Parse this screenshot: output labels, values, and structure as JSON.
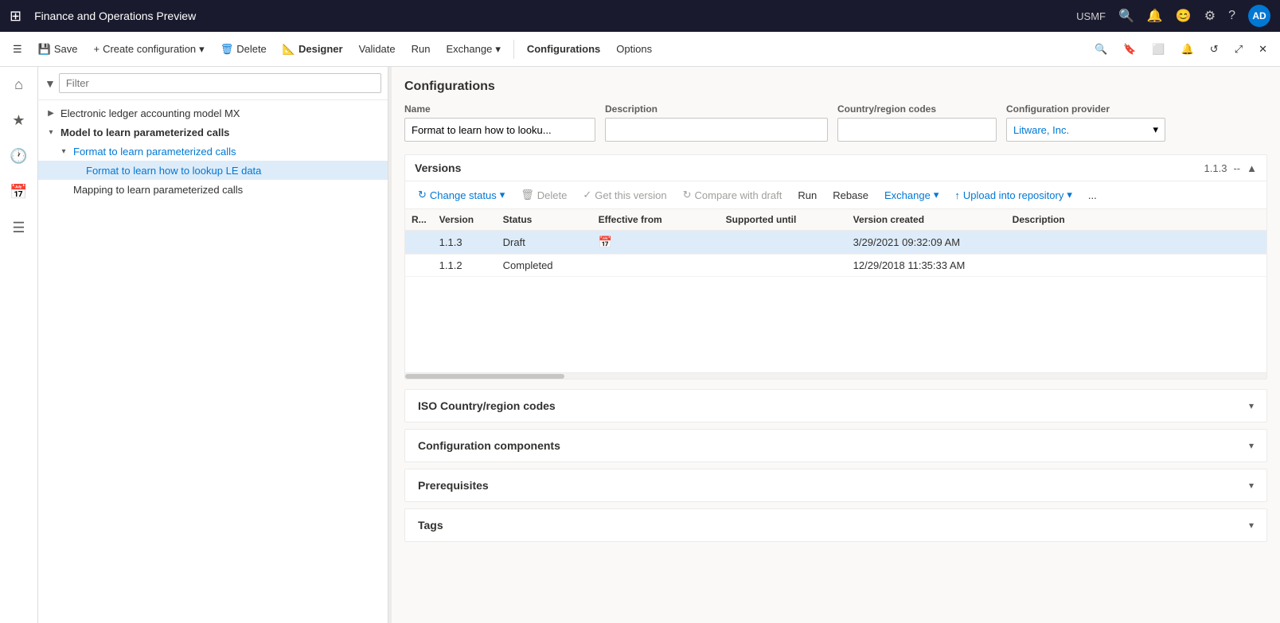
{
  "app": {
    "title": "Finance and Operations Preview",
    "user": "USMF",
    "initials": "AD"
  },
  "toolbar": {
    "save": "Save",
    "create_configuration": "Create configuration",
    "delete": "Delete",
    "designer": "Designer",
    "validate": "Validate",
    "run": "Run",
    "exchange": "Exchange",
    "configurations": "Configurations",
    "options": "Options"
  },
  "filter": {
    "placeholder": "Filter"
  },
  "tree": {
    "items": [
      {
        "id": "electronic",
        "label": "Electronic ledger accounting model MX",
        "level": 0,
        "toggle": "▶",
        "selected": false
      },
      {
        "id": "model",
        "label": "Model to learn parameterized calls",
        "level": 0,
        "toggle": "▾",
        "selected": false
      },
      {
        "id": "format",
        "label": "Format to learn parameterized calls",
        "level": 1,
        "toggle": "▾",
        "selected": false
      },
      {
        "id": "format-lookup",
        "label": "Format to learn how to lookup LE data",
        "level": 2,
        "toggle": "",
        "selected": true
      },
      {
        "id": "mapping",
        "label": "Mapping to learn parameterized calls",
        "level": 1,
        "toggle": "",
        "selected": false
      }
    ]
  },
  "main": {
    "section_title": "Configurations",
    "form": {
      "name_label": "Name",
      "name_value": "Format to learn how to looku...",
      "description_label": "Description",
      "description_value": "",
      "country_label": "Country/region codes",
      "country_value": "",
      "provider_label": "Configuration provider",
      "provider_value": "Litware, Inc."
    },
    "versions": {
      "title": "Versions",
      "badge": "1.1.3",
      "separator": "--",
      "toolbar": {
        "change_status": "Change status",
        "delete": "Delete",
        "get_this_version": "Get this version",
        "compare_with_draft": "Compare with draft",
        "run": "Run",
        "rebase": "Rebase",
        "exchange": "Exchange",
        "upload_into_repository": "Upload into repository",
        "more": "..."
      },
      "columns": {
        "r": "R...",
        "version": "Version",
        "status": "Status",
        "effective_from": "Effective from",
        "supported_until": "Supported until",
        "version_created": "Version created",
        "description": "Description"
      },
      "rows": [
        {
          "r": "",
          "version": "1.1.3",
          "status": "Draft",
          "effective_from": "",
          "has_calendar": true,
          "supported_until": "",
          "version_created": "3/29/2021 09:32:09 AM",
          "description": "",
          "selected": true
        },
        {
          "r": "",
          "version": "1.1.2",
          "status": "Completed",
          "effective_from": "",
          "has_calendar": false,
          "supported_until": "",
          "version_created": "12/29/2018 11:35:33 AM",
          "description": "",
          "selected": false
        }
      ]
    },
    "collapsible_sections": [
      {
        "id": "iso",
        "title": "ISO Country/region codes",
        "expanded": false
      },
      {
        "id": "components",
        "title": "Configuration components",
        "expanded": false
      },
      {
        "id": "prerequisites",
        "title": "Prerequisites",
        "expanded": false
      },
      {
        "id": "tags",
        "title": "Tags",
        "expanded": false
      }
    ]
  }
}
